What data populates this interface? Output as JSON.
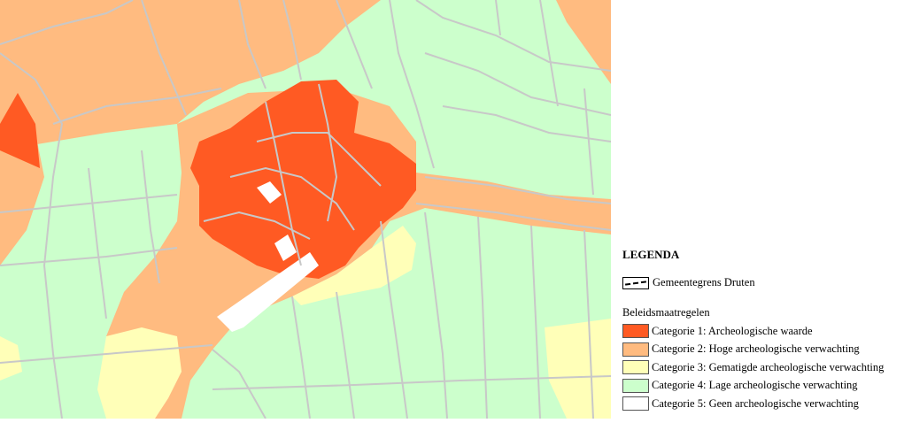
{
  "legend": {
    "title": "LEGENDA",
    "boundary_label": "Gemeentegrens Druten",
    "section_title": "Beleidsmaatregelen",
    "categories": [
      {
        "label": "Categorie 1: Archeologische waarde",
        "color": "#ff5a23"
      },
      {
        "label": "Categorie 2: Hoge archeologische verwachting",
        "color": "#ffbb80"
      },
      {
        "label": "Categorie 3: Gematigde archeologische verwachting",
        "color": "#ffffb8"
      },
      {
        "label": "Categorie 4: Lage archeologische verwachting",
        "color": "#ccffcc"
      },
      {
        "label": "Categorie 5: Geen archeologische verwachting",
        "color": "#ffffff"
      }
    ]
  },
  "map": {
    "colors": {
      "road": "#c8c8c8",
      "cat1": "#ff5a23",
      "cat2": "#ffbb80",
      "cat3": "#ffffb8",
      "cat4": "#ccffcc",
      "cat5": "#ffffff"
    }
  }
}
